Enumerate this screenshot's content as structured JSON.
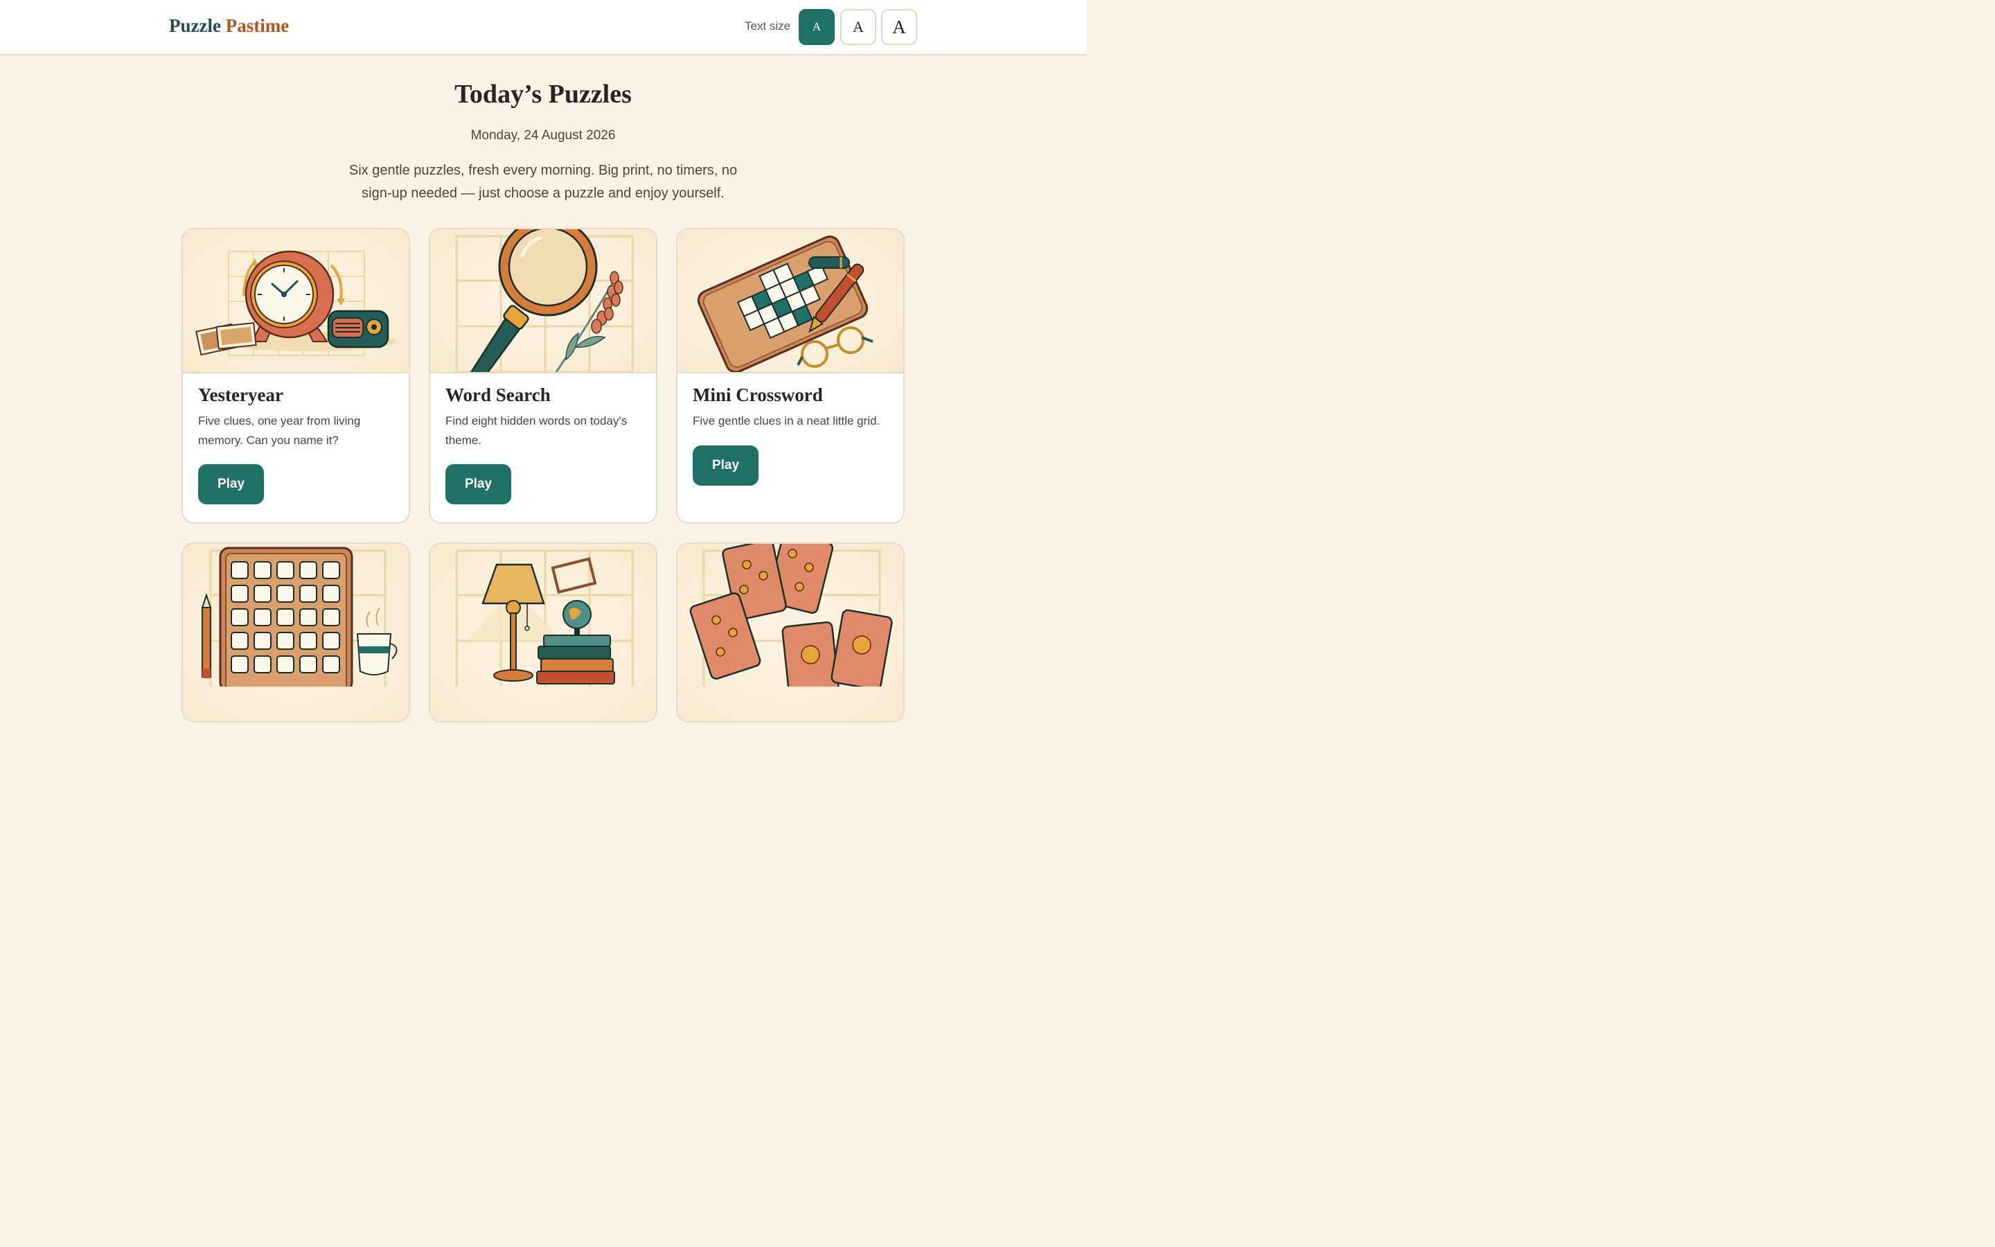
{
  "header": {
    "logo_part1": "Puzzle",
    "logo_part2": "Pastime",
    "text_size_label": "Text size",
    "text_size_options": [
      "A",
      "A",
      "A"
    ]
  },
  "main": {
    "title": "Today’s Puzzles",
    "date": "Monday, 24 August 2026",
    "intro": "Six gentle puzzles, fresh every morning. Big print, no timers, no sign-up needed — just choose a puzzle and enjoy yourself."
  },
  "cards": [
    {
      "title": "Yesteryear",
      "description": "Five clues, one year from living memory. Can you name it?",
      "button": "Play",
      "icon": "clock-radio-photos-illustration"
    },
    {
      "title": "Word Search",
      "description": "Find eight hidden words on today's theme.",
      "button": "Play",
      "icon": "magnifying-glass-lavender-illustration"
    },
    {
      "title": "Mini Crossword",
      "description": "Five gentle clues in a neat little grid.",
      "button": "Play",
      "icon": "crossword-board-pen-glasses-illustration"
    },
    {
      "icon": "letter-tile-rack-pencil-tea-illustration"
    },
    {
      "icon": "lamp-globe-books-illustration"
    },
    {
      "icon": "rose-playing-cards-illustration"
    }
  ],
  "colors": {
    "accent": "#1f7166",
    "brand_dark": "#1f4f4a",
    "brand_orange": "#b5541b",
    "background": "#f9f3e7"
  }
}
